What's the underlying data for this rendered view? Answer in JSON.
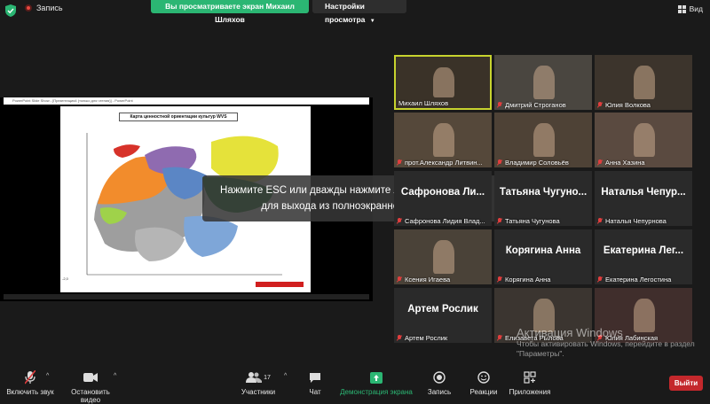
{
  "topbar": {
    "record_label": "Запись",
    "share_notice": "Вы просматриваете экран Михаил Шляхов",
    "view_settings": "Настройки просмотра",
    "view_label": "Вид"
  },
  "shared_screen": {
    "ppt_title": "PowerPoint Slide Show - [Презентация4 (только для чтения)] - PowerPoint",
    "slide_title": "Карта ценностной ориентации культур WVS",
    "overlay_line1": "Нажмите ESC или дважды нажмите левую кнопку мыши",
    "overlay_line2": "для выхода из полноэкранного режима"
  },
  "participants": [
    {
      "name": "Михаил Шляхов",
      "muted": false,
      "video": true,
      "active": true
    },
    {
      "name": "Дмитрий Строганов",
      "muted": true,
      "video": true
    },
    {
      "name": "Юлия Волкова",
      "muted": true,
      "video": true
    },
    {
      "name": "прот.Александр Литвин...",
      "muted": true,
      "video": true
    },
    {
      "name": "Владимир Соловьёв",
      "muted": true,
      "video": true
    },
    {
      "name": "Анна Хазина",
      "muted": true,
      "video": true
    },
    {
      "name": "Сафронова Лидия Влад...",
      "muted": true,
      "video": false,
      "big": "Сафронова Ли..."
    },
    {
      "name": "Татьяна Чугунова",
      "muted": true,
      "video": false,
      "big": "Татьяна Чугуно..."
    },
    {
      "name": "Наталья Чепурнова",
      "muted": true,
      "video": false,
      "big": "Наталья Чепур..."
    },
    {
      "name": "Ксения Игаева",
      "muted": true,
      "video": true
    },
    {
      "name": "Корягина Анна",
      "muted": true,
      "video": false,
      "big": "Корягина Анна"
    },
    {
      "name": "Екатерина Легостина",
      "muted": true,
      "video": false,
      "big": "Екатерина Лег..."
    },
    {
      "name": "Артем Рослик",
      "muted": true,
      "video": false,
      "big": "Артем Рослик"
    },
    {
      "name": "Елизавета Рылова",
      "muted": true,
      "video": true
    },
    {
      "name": "Юлия Лабинская",
      "muted": true,
      "video": true
    }
  ],
  "windows_activation": {
    "title": "Активация Windows",
    "body": "Чтобы активировать Windows, перейдите в раздел \"Параметры\"."
  },
  "toolbar": {
    "audio": "Включить звук",
    "video": "Остановить видео",
    "participants": "Участники",
    "participants_count": "17",
    "chat": "Чат",
    "share": "Демонстрация экрана",
    "record": "Запись",
    "reactions": "Реакции",
    "apps": "Приложения",
    "leave": "Выйти"
  },
  "colors": {
    "share_green": "#2bb673",
    "leave_red": "#c4282c",
    "active_speaker": "#c7d32e",
    "muted_red": "#e03e3e"
  }
}
